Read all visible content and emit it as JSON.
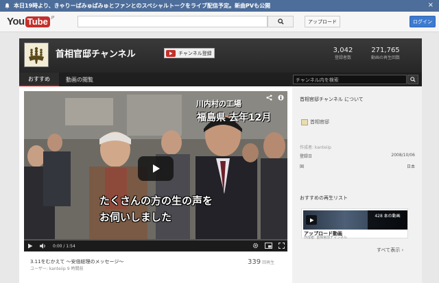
{
  "notice": {
    "message": "本日19時より、きゃりーぱみゅぱみゅとファンとのスペシャルトークをライブ配信予定。新曲PVも公開",
    "close": "×"
  },
  "masthead": {
    "logo_you": "You",
    "logo_tube": "Tube",
    "logo_region": "JP",
    "search_placeholder": "",
    "upload_label": "アップロード",
    "login_label": "ログイン"
  },
  "channel": {
    "title": "首相官邸チャンネル",
    "subscribe_label": "チャンネル登録",
    "subscribers_value": "3,042",
    "subscribers_label": "登録者数",
    "views_value": "271,765",
    "views_label": "動画の再生回数"
  },
  "nav": {
    "tabs": [
      {
        "label": "おすすめ",
        "active": true
      },
      {
        "label": "動画の閲覧",
        "active": false
      }
    ],
    "search_placeholder": "チャンネル内を検索"
  },
  "video": {
    "overlay_label_top": "川内村の工場",
    "overlay_label_main": "福島県 去年12月",
    "caption_line1": "たくさんの方の生の声を",
    "caption_line2": "お伺いしました",
    "time": "0:00 / 1:54",
    "progress": 0,
    "title": "3.11をむかえて ～安倍総理のメッセージ～",
    "meta": "ユーザー: kanteiip 9 時間前",
    "views_count": "339",
    "views_unit": "回再生"
  },
  "sidebar": {
    "about_title": "首相官邸チャンネル について",
    "owner_name": "首相官邸",
    "author_line": "作成者: kanteiip",
    "registered_label": "登録日",
    "registered_value": "2008/10/06",
    "country_label": "国",
    "country_value": "日本",
    "recommended_title": "おすすめの再生リスト",
    "playlist": {
      "count": "428 本の動画",
      "title": "アップロード動画",
      "author": "作成者: 首相官邸チャンネル"
    },
    "show_all": "すべて表示 ›"
  },
  "colors": {
    "notice_bg": "#4d6d9a",
    "login_bg": "#3d7bd0",
    "youtube_red": "#c4302b",
    "channel_header": "#2f2f2f"
  }
}
